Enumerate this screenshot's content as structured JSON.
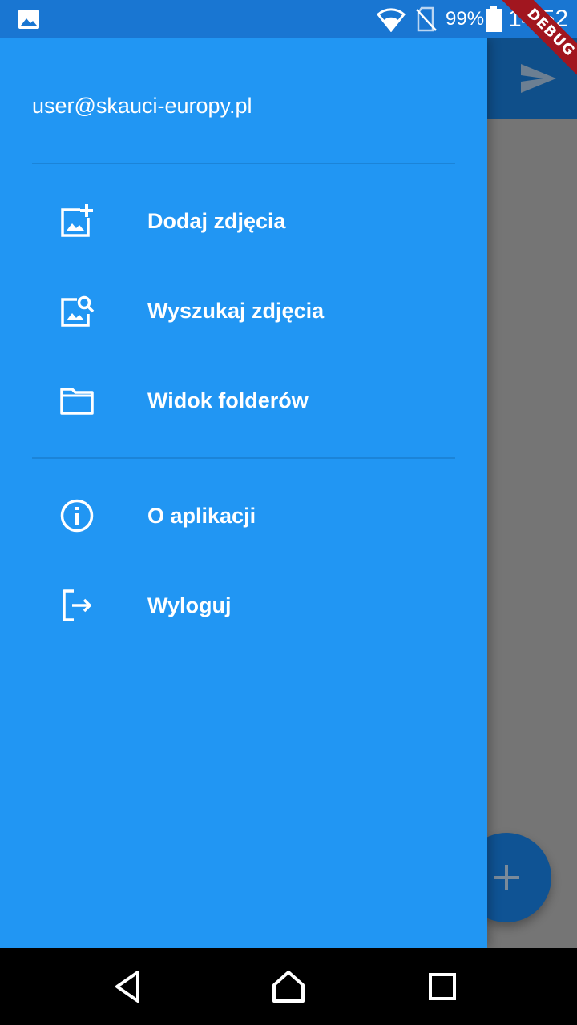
{
  "status_bar": {
    "battery_percent": "99%",
    "time": "14:52",
    "icons": [
      "gallery-icon",
      "wifi-icon",
      "no-sim-icon",
      "battery-icon"
    ]
  },
  "debug_banner": {
    "label": "DEBUG"
  },
  "drawer": {
    "account_email": "user@skauci-europy.pl",
    "items": [
      {
        "label": "Dodaj zdjęcia",
        "icon": "add-photo-icon"
      },
      {
        "label": "Wyszukaj zdjęcia",
        "icon": "image-search-icon"
      },
      {
        "label": "Widok folderów",
        "icon": "folder-icon"
      },
      {
        "label": "O aplikacji",
        "icon": "info-icon"
      },
      {
        "label": "Wyloguj",
        "icon": "logout-icon"
      }
    ]
  },
  "app_bar": {
    "action_icon": "send-icon"
  },
  "fab": {
    "icon": "plus-icon"
  },
  "navigation_bar": {
    "buttons": [
      "back-icon",
      "home-icon",
      "recents-icon"
    ]
  },
  "colors": {
    "drawer": "#2196f3",
    "status_bar": "#1976d2",
    "scrim": "#757575",
    "app_bar_dimmed": "#0f4f8a",
    "debug_banner": "#a1161f"
  }
}
